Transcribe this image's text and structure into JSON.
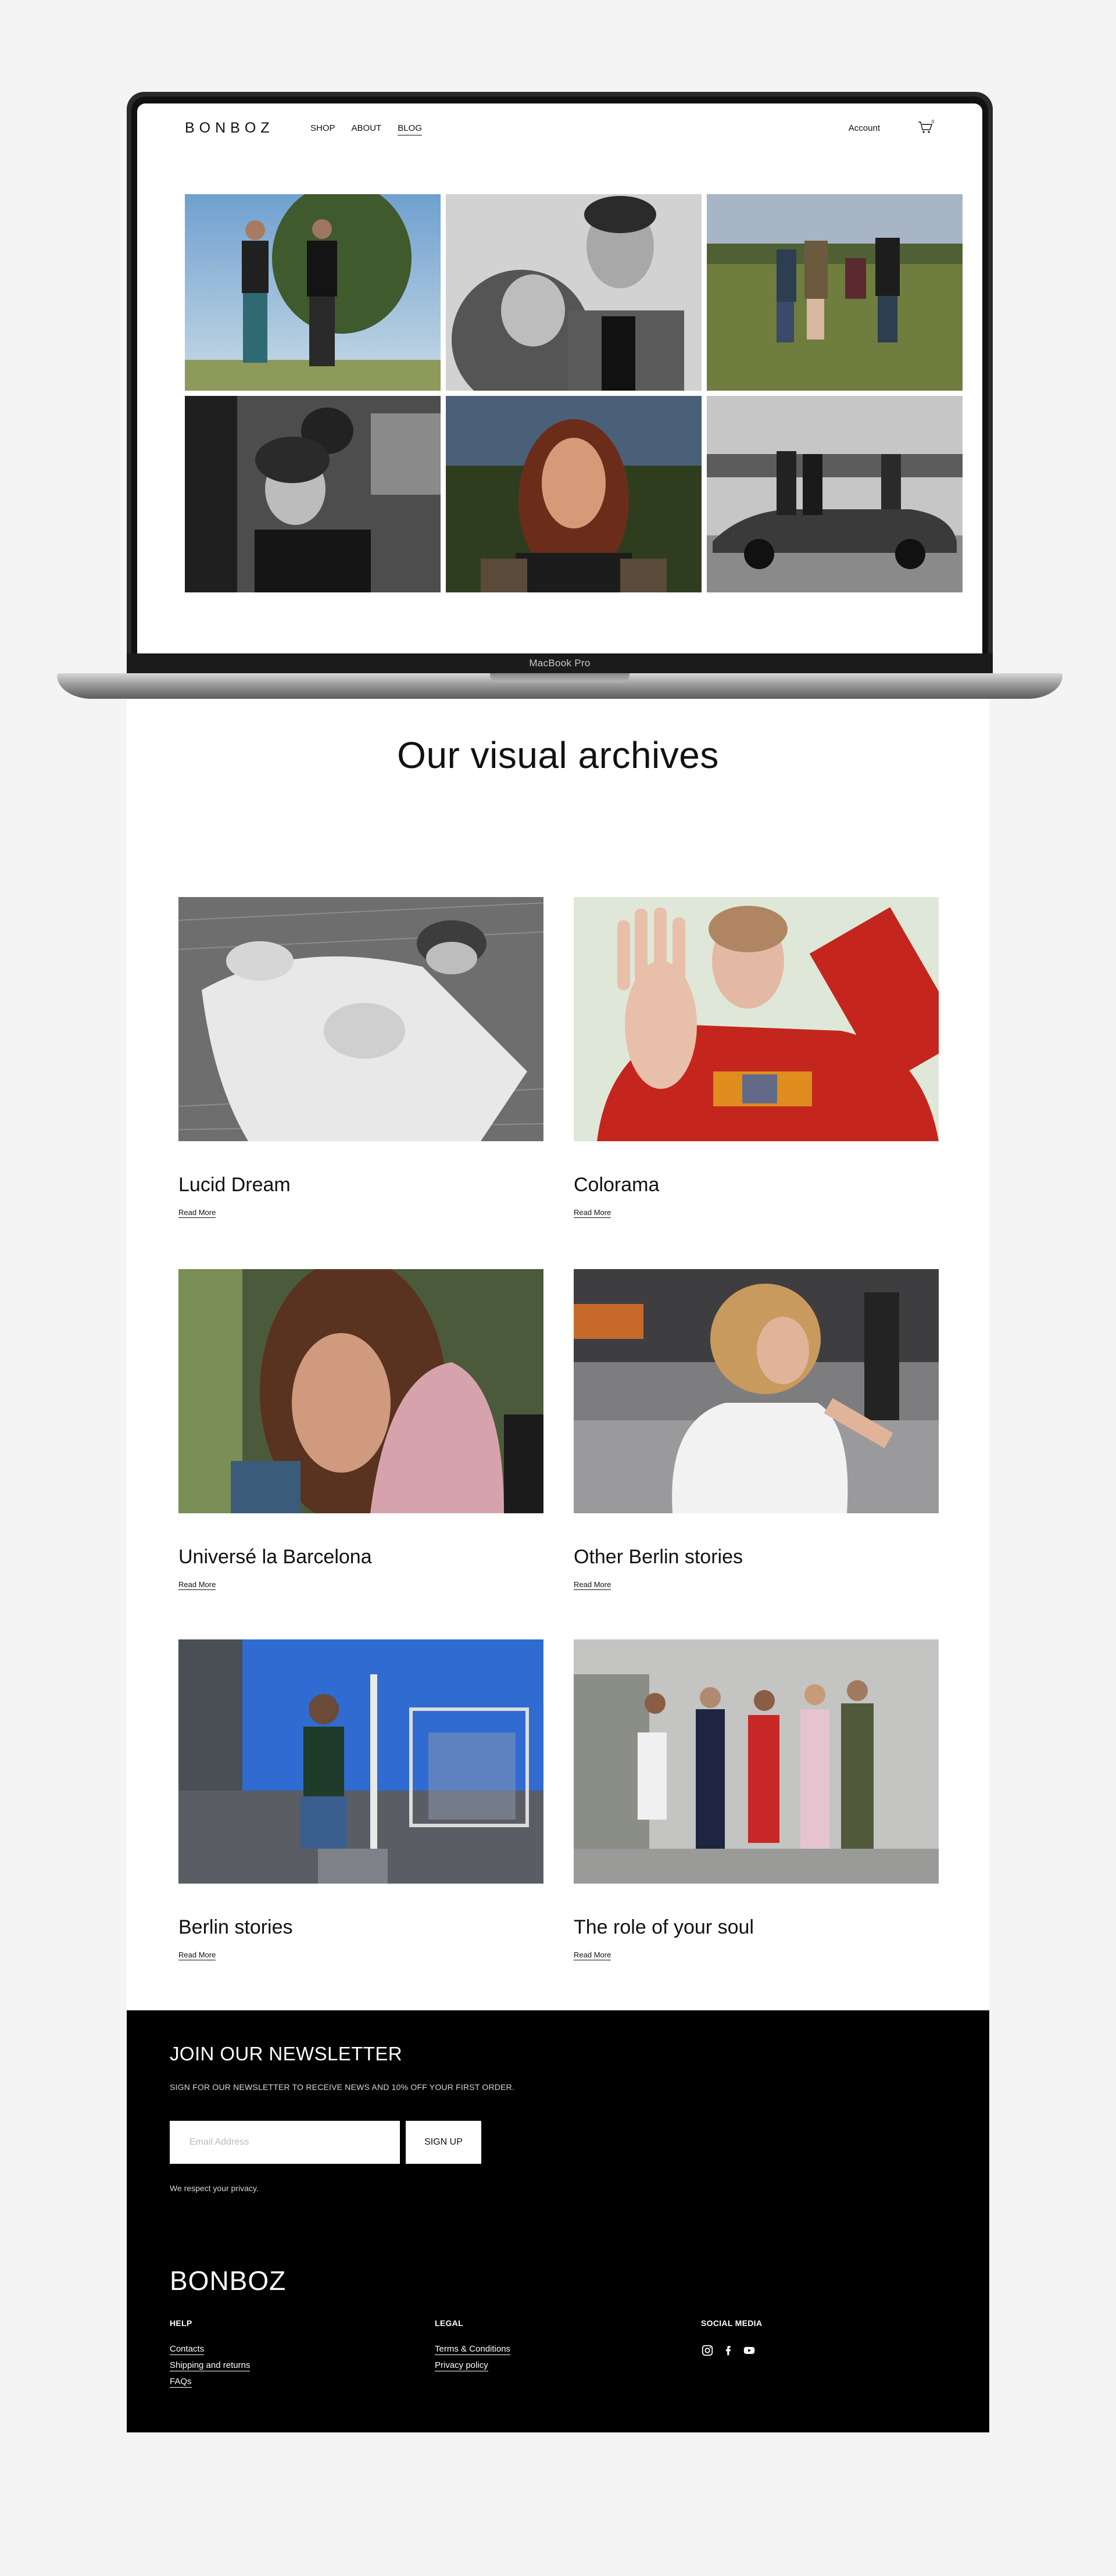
{
  "device": {
    "label": "MacBook Pro"
  },
  "screen": {
    "logo": "BONBOZ",
    "nav": [
      "SHOP",
      "ABOUT",
      "BLOG"
    ],
    "nav_active": "BLOG",
    "account_label": "Account",
    "cart_count": "0",
    "gallery": [
      "two-men-field-photo",
      "bw-couple-portrait-photo",
      "group-dancing-field-photo",
      "bw-couple-car-photo",
      "red-hair-portrait-photo",
      "bw-friends-convertible-photo"
    ]
  },
  "archives": {
    "title": "Our visual archives",
    "read_more_label": "Read More",
    "posts": [
      {
        "title": "Lucid Dream"
      },
      {
        "title": "Colorama"
      },
      {
        "title": "Universé la Barcelona"
      },
      {
        "title": "Other Berlin stories"
      },
      {
        "title": "Berlin stories"
      },
      {
        "title": "The role of your soul"
      }
    ]
  },
  "newsletter": {
    "title": "JOIN OUR NEWSLETTER",
    "description": "SIGN FOR OUR NEWSLETTER TO RECEIVE NEWS AND 10% OFF YOUR FIRST ORDER.",
    "email_placeholder": "Email Address",
    "button_label": "SIGN UP",
    "privacy_note": "We respect your privacy."
  },
  "footer": {
    "logo": "BONBOZ",
    "help": {
      "heading": "HELP",
      "links": [
        "Contacts",
        "Shipping and returns",
        "FAQs"
      ]
    },
    "legal": {
      "heading": "LEGAL",
      "links": [
        "Terms & Conditions",
        "Privacy policy"
      ]
    },
    "social": {
      "heading": "SOCIAL MEDIA",
      "icons": [
        "instagram-icon",
        "facebook-icon",
        "youtube-icon"
      ]
    }
  }
}
